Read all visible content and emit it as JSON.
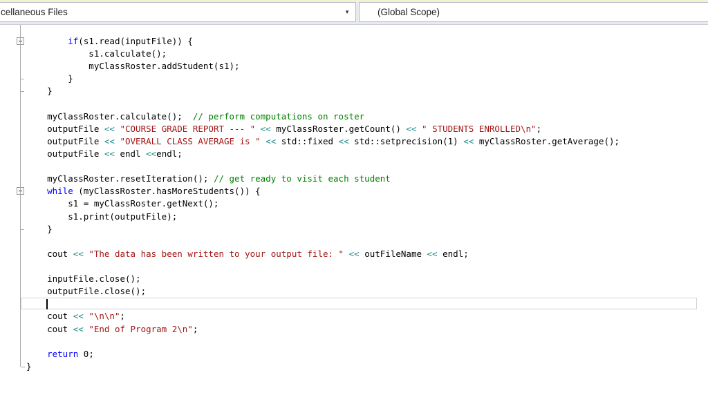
{
  "navbar": {
    "types_dropdown_text": "cellaneous Files",
    "scope_dropdown_text": "(Global Scope)",
    "dropdown_arrow_icon": "▼"
  },
  "colors": {
    "plain": "#000000",
    "keyword": "#0000ff",
    "string": "#a31515",
    "comment": "#008000",
    "operator": "#1b8a8a"
  },
  "editor": {
    "cursor_line": 21,
    "cursor_col": 4,
    "lines": [
      {
        "fold": "minus",
        "segments": [
          [
            "p",
            "        "
          ],
          [
            "k",
            "if"
          ],
          [
            "p",
            "(s1.read(inputFile)) {"
          ]
        ]
      },
      {
        "fold": null,
        "segments": [
          [
            "p",
            "            s1.calculate();"
          ]
        ]
      },
      {
        "fold": null,
        "segments": [
          [
            "p",
            "            myClassRoster.addStudent(s1);"
          ]
        ]
      },
      {
        "fold": "tick",
        "segments": [
          [
            "p",
            "        }"
          ]
        ]
      },
      {
        "fold": "tick",
        "segments": [
          [
            "p",
            "    }"
          ]
        ]
      },
      {
        "fold": null,
        "segments": []
      },
      {
        "fold": null,
        "segments": [
          [
            "p",
            "    myClassRoster.calculate();  "
          ],
          [
            "c",
            "// perform computations on roster"
          ]
        ]
      },
      {
        "fold": null,
        "segments": [
          [
            "p",
            "    outputFile "
          ],
          [
            "o",
            "<<"
          ],
          [
            "p",
            " "
          ],
          [
            "s",
            "\"COURSE GRADE REPORT --- \""
          ],
          [
            "p",
            " "
          ],
          [
            "o",
            "<<"
          ],
          [
            "p",
            " myClassRoster.getCount() "
          ],
          [
            "o",
            "<<"
          ],
          [
            "p",
            " "
          ],
          [
            "s",
            "\" STUDENTS ENROLLED\\n\""
          ],
          [
            "p",
            ";"
          ]
        ]
      },
      {
        "fold": null,
        "segments": [
          [
            "p",
            "    outputFile "
          ],
          [
            "o",
            "<<"
          ],
          [
            "p",
            " "
          ],
          [
            "s",
            "\"OVERALL CLASS AVERAGE is \""
          ],
          [
            "p",
            " "
          ],
          [
            "o",
            "<<"
          ],
          [
            "p",
            " std::fixed "
          ],
          [
            "o",
            "<<"
          ],
          [
            "p",
            " std::setprecision(1) "
          ],
          [
            "o",
            "<<"
          ],
          [
            "p",
            " myClassRoster.getAverage();"
          ]
        ]
      },
      {
        "fold": null,
        "segments": [
          [
            "p",
            "    outputFile "
          ],
          [
            "o",
            "<<"
          ],
          [
            "p",
            " endl "
          ],
          [
            "o",
            "<<"
          ],
          [
            "p",
            "endl;"
          ]
        ]
      },
      {
        "fold": null,
        "segments": []
      },
      {
        "fold": null,
        "segments": [
          [
            "p",
            "    myClassRoster.resetIteration(); "
          ],
          [
            "c",
            "// get ready to visit each student"
          ]
        ]
      },
      {
        "fold": "minus",
        "segments": [
          [
            "p",
            "    "
          ],
          [
            "k",
            "while"
          ],
          [
            "p",
            " (myClassRoster.hasMoreStudents()) {"
          ]
        ]
      },
      {
        "fold": null,
        "segments": [
          [
            "p",
            "        s1 = myClassRoster.getNext();"
          ]
        ]
      },
      {
        "fold": null,
        "segments": [
          [
            "p",
            "        s1.print(outputFile);"
          ]
        ]
      },
      {
        "fold": "tick",
        "segments": [
          [
            "p",
            "    }"
          ]
        ]
      },
      {
        "fold": null,
        "segments": []
      },
      {
        "fold": null,
        "segments": [
          [
            "p",
            "    cout "
          ],
          [
            "o",
            "<<"
          ],
          [
            "p",
            " "
          ],
          [
            "s",
            "\"The data has been written to your output file: \""
          ],
          [
            "p",
            " "
          ],
          [
            "o",
            "<<"
          ],
          [
            "p",
            " outFileName "
          ],
          [
            "o",
            "<<"
          ],
          [
            "p",
            " endl;"
          ]
        ]
      },
      {
        "fold": null,
        "segments": []
      },
      {
        "fold": null,
        "segments": [
          [
            "p",
            "    inputFile.close();"
          ]
        ]
      },
      {
        "fold": null,
        "segments": [
          [
            "p",
            "    outputFile.close();"
          ]
        ]
      },
      {
        "fold": null,
        "segments": [
          [
            "p",
            "    "
          ]
        ]
      },
      {
        "fold": null,
        "segments": [
          [
            "p",
            "    cout "
          ],
          [
            "o",
            "<<"
          ],
          [
            "p",
            " "
          ],
          [
            "s",
            "\"\\n\\n\""
          ],
          [
            "p",
            ";"
          ]
        ]
      },
      {
        "fold": null,
        "segments": [
          [
            "p",
            "    cout "
          ],
          [
            "o",
            "<<"
          ],
          [
            "p",
            " "
          ],
          [
            "s",
            "\"End of Program 2\\n\""
          ],
          [
            "p",
            ";"
          ]
        ]
      },
      {
        "fold": null,
        "segments": []
      },
      {
        "fold": null,
        "segments": [
          [
            "p",
            "    "
          ],
          [
            "k",
            "return"
          ],
          [
            "p",
            " 0;"
          ]
        ]
      },
      {
        "fold": "end",
        "segments": [
          [
            "p",
            "}"
          ]
        ]
      }
    ]
  }
}
